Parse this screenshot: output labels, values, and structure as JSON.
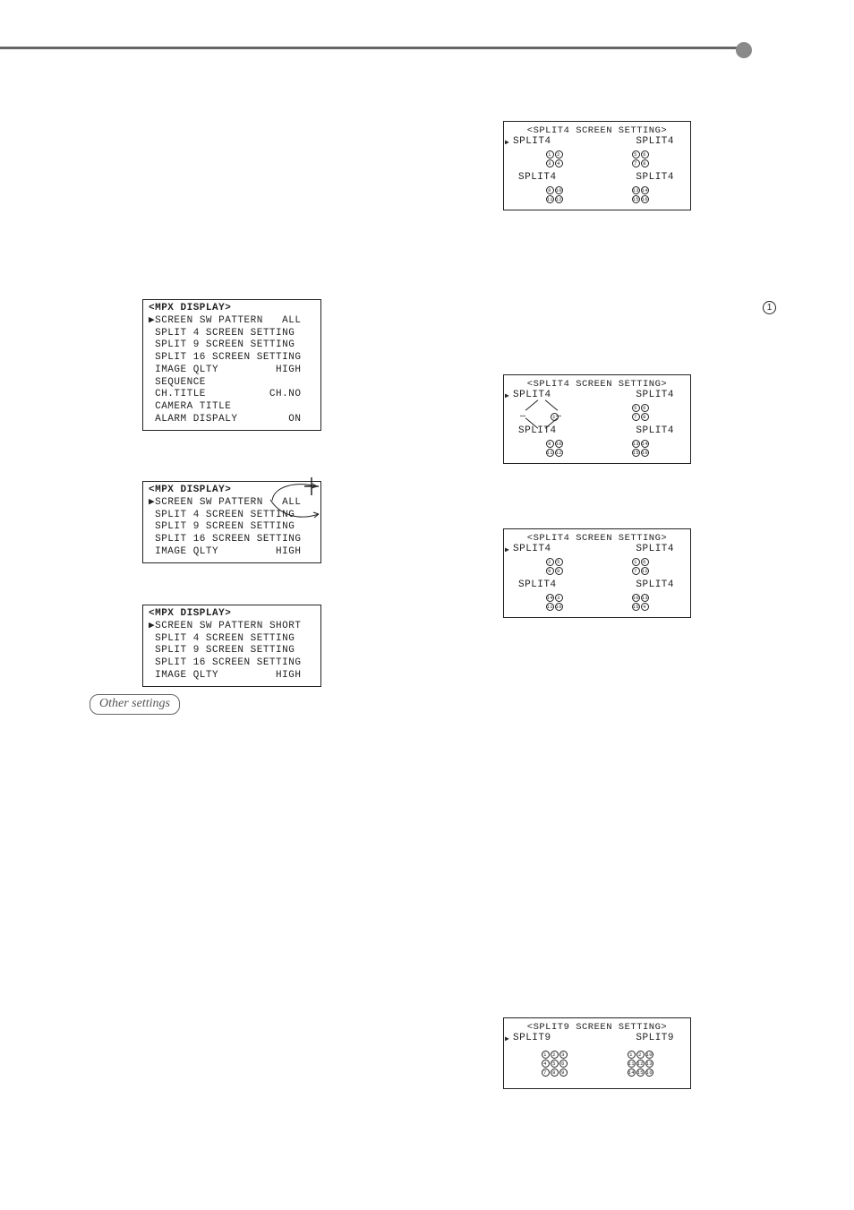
{
  "header": {},
  "marker_right": "1",
  "menu_full": {
    "title": "<MPX DISPLAY>",
    "lines": [
      "▶SCREEN SW PATTERN   ALL",
      " SPLIT 4 SCREEN SETTING",
      " SPLIT 9 SCREEN SETTING",
      " SPLIT 16 SCREEN SETTING",
      " IMAGE QLTY         HIGH",
      " SEQUENCE",
      " CH.TITLE          CH.NO",
      " CAMERA TITLE",
      " ALARM DISPALY        ON"
    ]
  },
  "menu_all": {
    "title": "<MPX DISPLAY>",
    "lines": [
      "▶SCREEN SW PATTERN   ALL",
      " SPLIT 4 SCREEN SETTING",
      " SPLIT 9 SCREEN SETTING",
      " SPLIT 16 SCREEN SETTING",
      " IMAGE QLTY         HIGH"
    ]
  },
  "menu_short": {
    "title": "<MPX DISPLAY>",
    "lines": [
      "▶SCREEN SW PATTERN SHORT",
      " SPLIT 4 SCREEN SETTING",
      " SPLIT 9 SCREEN SETTING",
      " SPLIT 16 SCREEN SETTING",
      " IMAGE QLTY         HIGH"
    ]
  },
  "other_settings_label": "Other settings",
  "split4_a": {
    "title": "<SPLIT4 SCREEN SETTING>",
    "labels": [
      "SPLIT4",
      "SPLIT4",
      "SPLIT4",
      "SPLIT4"
    ],
    "grids": [
      [
        "1",
        "2",
        "3",
        "4"
      ],
      [
        "5",
        "6",
        "7",
        "8"
      ],
      [
        "9",
        "10",
        "11",
        "12"
      ],
      [
        "13",
        "14",
        "15",
        "16"
      ]
    ]
  },
  "split4_b": {
    "title": "<SPLIT4 SCREEN SETTING>",
    "labels": [
      "SPLIT4",
      "SPLIT4",
      "SPLIT4",
      "SPLIT4"
    ],
    "grids": [
      [
        "",
        "",
        "1",
        ""
      ],
      [
        "5",
        "6",
        "7",
        "8"
      ],
      [
        "9",
        "10",
        "11",
        "12"
      ],
      [
        "13",
        "14",
        "15",
        "16"
      ]
    ],
    "highlighted_quad": 0
  },
  "split4_c": {
    "title": "<SPLIT4 SCREEN SETTING>",
    "labels": [
      "SPLIT4",
      "SPLIT4",
      "SPLIT4",
      "SPLIT4"
    ],
    "grids": [
      [
        "2",
        "5",
        "9",
        "8"
      ],
      [
        "1",
        "6",
        "7",
        "12"
      ],
      [
        "14",
        "3",
        "11",
        "16"
      ],
      [
        "10",
        "13",
        "15",
        "4"
      ]
    ]
  },
  "split9": {
    "title": "<SPLIT9 SCREEN SETTING>",
    "labels": [
      "SPLIT9",
      "SPLIT9"
    ],
    "grids": [
      [
        "1",
        "2",
        "3",
        "4",
        "5",
        "6",
        "7",
        "8",
        "9"
      ],
      [
        "1",
        "2",
        "10",
        "11",
        "12",
        "13",
        "14",
        "15",
        "16"
      ]
    ]
  }
}
